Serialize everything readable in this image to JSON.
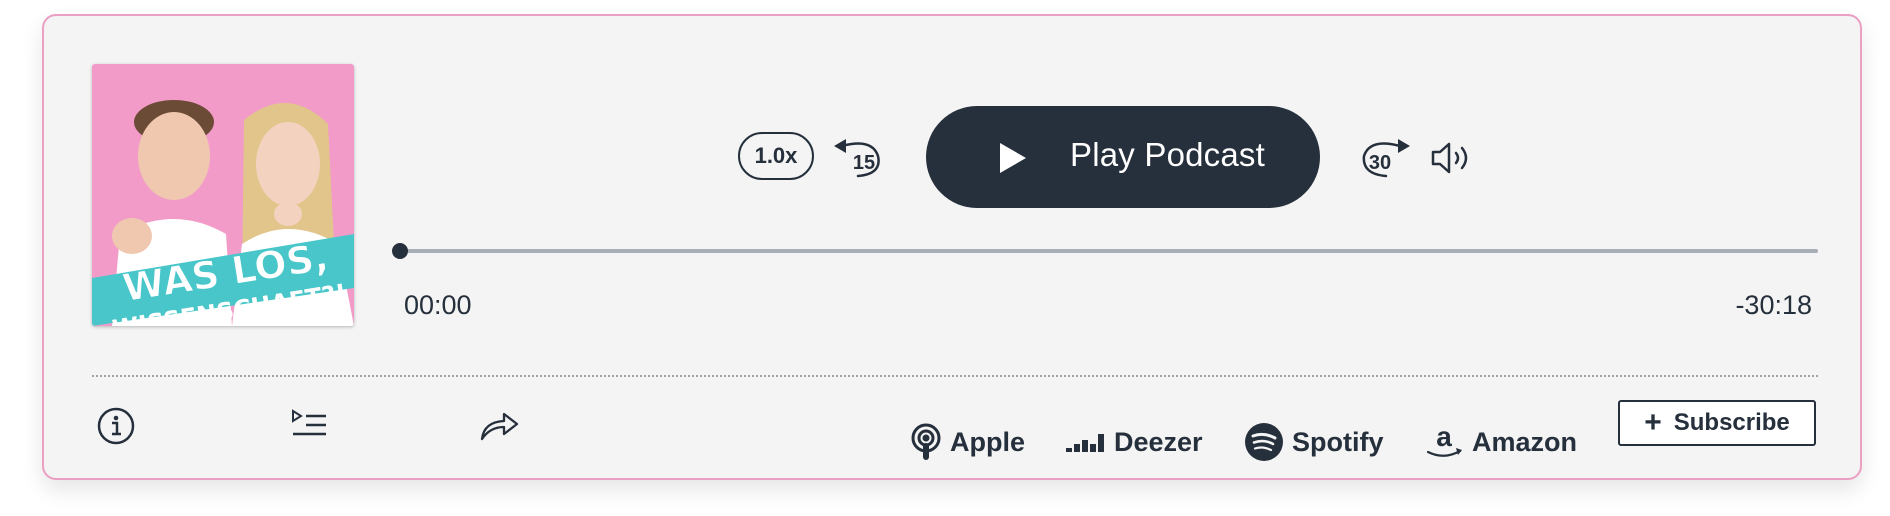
{
  "player": {
    "cover_text": {
      "line1": "WAS LOS,",
      "line2": "WISSENSCHAFT?!"
    },
    "speed_label": "1.0x",
    "skip_back_label": "15",
    "skip_forward_label": "30",
    "play_label": "Play Podcast",
    "progress": 0.0,
    "time_elapsed": "00:00",
    "time_remaining": "-30:18"
  },
  "footer": {
    "services": [
      {
        "label": "Apple",
        "icon": "apple-podcasts-icon"
      },
      {
        "label": "Deezer",
        "icon": "deezer-icon"
      },
      {
        "label": "Spotify",
        "icon": "spotify-icon"
      },
      {
        "label": "Amazon",
        "icon": "amazon-icon"
      }
    ],
    "subscribe_label": "Subscribe",
    "actions": [
      "info-icon",
      "playlist-icon",
      "share-icon"
    ]
  },
  "colors": {
    "accent_border": "#eb9fc2",
    "primary": "#262f3c",
    "card_bg": "#f4f4f4",
    "cover_pink": "#f29bc8",
    "cover_teal": "#49c6c9"
  }
}
